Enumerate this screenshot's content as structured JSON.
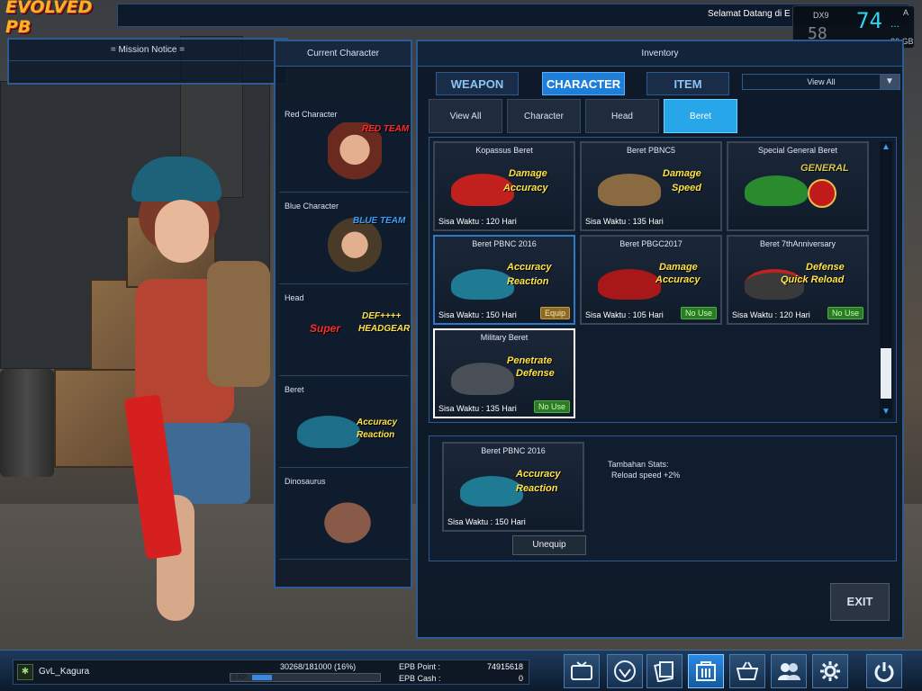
{
  "header": {
    "logo": "EVOLVED PB",
    "welcome": "Selamat Datang di E"
  },
  "fps_overlay": {
    "dx": "DX9",
    "fps": "74",
    "sub_value": "58",
    "dots": "...",
    "letter": "A",
    "memory": "26 GB"
  },
  "mission": {
    "title": "= Mission Notice ="
  },
  "current_character": {
    "title": "Current Character",
    "slots": [
      {
        "label": "Red Character",
        "tag": "RED TEAM"
      },
      {
        "label": "Blue Character",
        "tag": "BLUE TEAM"
      },
      {
        "label": "Head",
        "tag": "Super",
        "tag2": "DEF++++",
        "tag3": "HEADGEAR"
      },
      {
        "label": "Beret",
        "stat1": "Accuracy",
        "stat2": "Reaction"
      },
      {
        "label": "Dinosaurus"
      }
    ]
  },
  "inventory": {
    "title": "Inventory",
    "tabs": [
      "WEAPON",
      "CHARACTER",
      "ITEM"
    ],
    "active_tab": "CHARACTER",
    "filter_dropdown": "View All",
    "subtabs": [
      "View All",
      "Character",
      "Head",
      "Beret"
    ],
    "active_subtab": "Beret",
    "items": [
      {
        "name": "Kopassus Beret",
        "time": "Sisa Waktu : 120 Hari",
        "stats": [
          "Damage",
          "Accuracy"
        ],
        "badge": "",
        "color": "#c0211e"
      },
      {
        "name": "Beret PBNC5",
        "time": "Sisa Waktu : 135 Hari",
        "stats": [
          "Damage",
          "Speed"
        ],
        "badge": "",
        "color": "#8a6a40"
      },
      {
        "name": "Special General Beret",
        "time": "",
        "stats": [
          "GENERAL"
        ],
        "badge": "",
        "color": "#2a8a2e"
      },
      {
        "name": "Beret PBNC 2016",
        "time": "Sisa Waktu : 150 Hari",
        "stats": [
          "Accuracy",
          "Reaction"
        ],
        "badge": "Equip",
        "color": "#1f7a94"
      },
      {
        "name": "Beret PBGC2017",
        "time": "Sisa Waktu : 105 Hari",
        "stats": [
          "Damage",
          "Accuracy"
        ],
        "badge": "No Use",
        "color": "#a81818"
      },
      {
        "name": "Beret 7thAnniversary",
        "time": "Sisa Waktu : 120 Hari",
        "stats": [
          "Defense",
          "Quick Reload"
        ],
        "badge": "No Use",
        "color": "#3a3a3a"
      },
      {
        "name": "Military Beret",
        "time": "Sisa Waktu : 135 Hari",
        "stats": [
          "Penetrate",
          "Defense"
        ],
        "badge": "No Use",
        "color": "#4a4e56"
      }
    ],
    "detail": {
      "name": "Beret PBNC 2016",
      "time": "Sisa Waktu : 150 Hari",
      "stats": [
        "Accuracy",
        "Reaction"
      ],
      "stats_title": "Tambahan Stats:",
      "stats_line": "Reload speed +2%",
      "unequip": "Unequip"
    },
    "exit": "EXIT"
  },
  "status_bar": {
    "player_name": "GvL_Kagura",
    "exp_text": "30268/181000 (16%)",
    "exp_label": "EXP",
    "exp_progress": 0.16,
    "epb_point_label": "EPB Point :",
    "epb_point": "74915618",
    "epb_cash_label": "EPB Cash :",
    "epb_cash": "0"
  },
  "nav_icons": [
    "tv-icon",
    "clan-emblem-icon",
    "card-icon",
    "inventory-icon",
    "shop-basket-icon",
    "community-icon",
    "settings-gear-icon",
    "power-icon"
  ]
}
